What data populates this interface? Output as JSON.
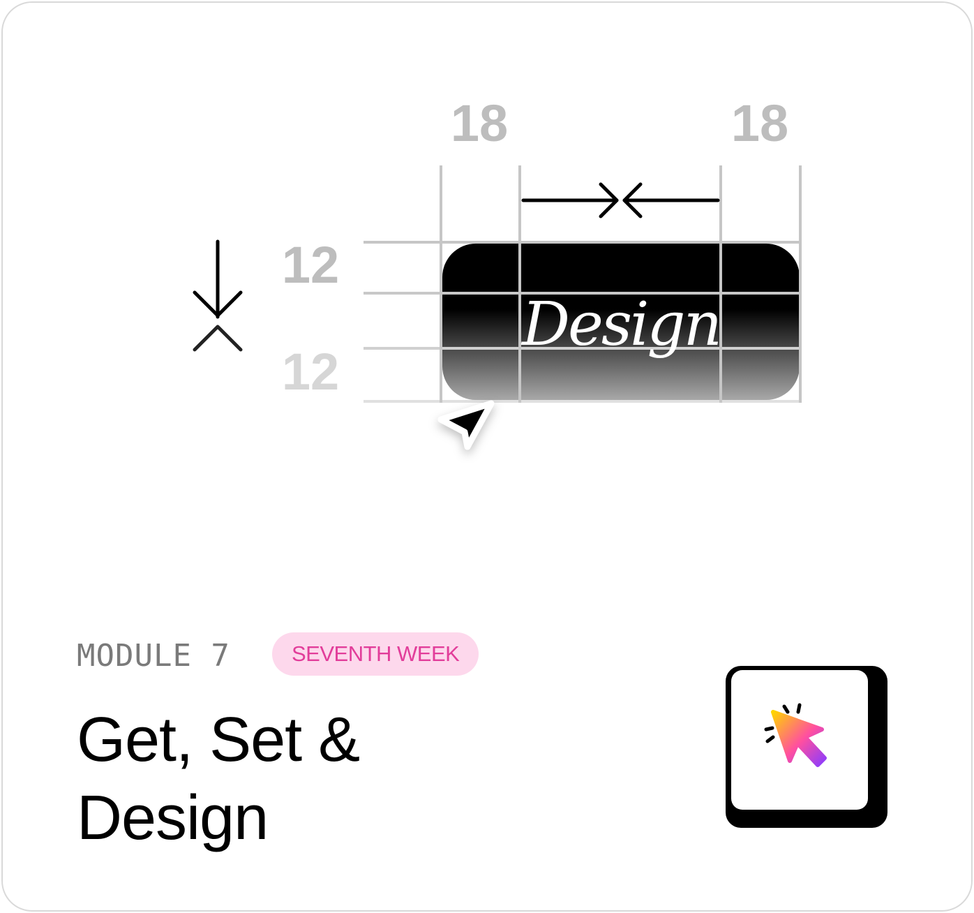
{
  "illustration": {
    "spacing_horizontal_left": "18",
    "spacing_horizontal_right": "18",
    "spacing_vertical_top": "12",
    "spacing_vertical_bottom": "12",
    "button_label": "Design",
    "cursor_icon": "arrow-cursor-icon"
  },
  "module": {
    "label": "MODULE 7",
    "badge": "SEVENTH WEEK",
    "title_line_1": "Get, Set &",
    "title_line_2": "Design"
  },
  "keycap": {
    "icon": "click-cursor-icon",
    "gradient_colors": [
      "#ffd400",
      "#ff4fa0",
      "#8a3cff"
    ]
  },
  "colors": {
    "badge_bg": "#fdd8ec",
    "badge_text": "#e23d9a",
    "grid_line": "#c8c8c8",
    "number_gray": "#bdbdbd"
  }
}
